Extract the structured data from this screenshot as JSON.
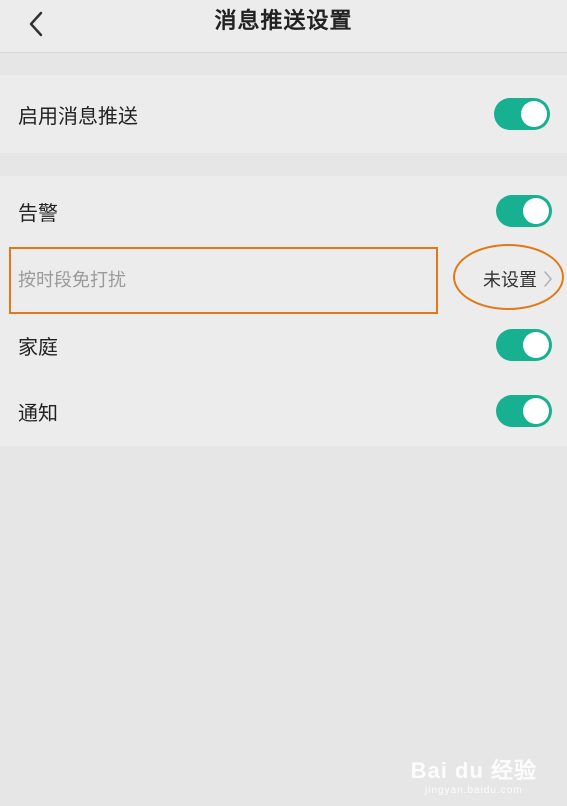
{
  "header": {
    "title": "消息推送设置",
    "back_icon": "chevron-left-icon"
  },
  "section_push": {
    "enable_label": "启用消息推送",
    "enable_on": true
  },
  "section_types": {
    "alarm_label": "告警",
    "alarm_on": true,
    "dnd_label": "按时段免打扰",
    "dnd_value": "未设置",
    "home_label": "家庭",
    "home_on": true,
    "notice_label": "通知",
    "notice_on": true
  },
  "colors": {
    "toggle_on": "#17b090",
    "highlight": "#e07a18",
    "background": "#e6e6e6",
    "card": "#ececec"
  },
  "watermark": {
    "logo": "Bai du 经验",
    "sub": "jingyan.baidu.com"
  }
}
